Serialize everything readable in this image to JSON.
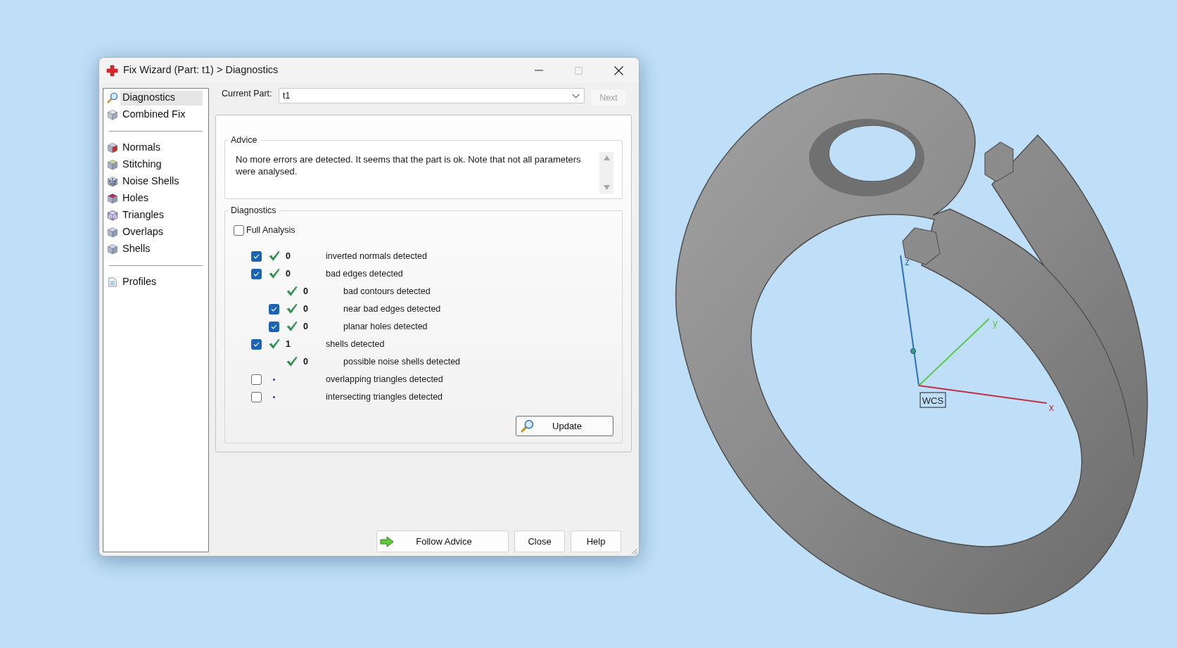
{
  "window": {
    "title": "Fix Wizard (Part: t1) > Diagnostics",
    "controls": [
      {
        "kind": "minimize",
        "disabled": false
      },
      {
        "kind": "maximize",
        "disabled": true
      },
      {
        "kind": "close",
        "disabled": false
      }
    ]
  },
  "sidebar": {
    "groups": [
      {
        "items": [
          {
            "label": "Diagnostics",
            "selected": true
          },
          {
            "label": "Combined Fix",
            "selected": false
          }
        ]
      },
      {
        "items": [
          {
            "label": "Normals",
            "selected": false
          },
          {
            "label": "Stitching",
            "selected": false
          },
          {
            "label": "Noise Shells",
            "selected": false
          },
          {
            "label": "Holes",
            "selected": false
          },
          {
            "label": "Triangles",
            "selected": false
          },
          {
            "label": "Overlaps",
            "selected": false
          },
          {
            "label": "Shells",
            "selected": false
          }
        ]
      },
      {
        "items": [
          {
            "label": "Profiles",
            "selected": false
          }
        ]
      }
    ]
  },
  "part_selector": {
    "label": "Current Part:",
    "value": "t1"
  },
  "next_button": {
    "label": "Next",
    "disabled": true
  },
  "advice": {
    "title": "Advice",
    "text": "No more errors are detected. It seems that the part is ok. Note that not all parameters were analysed."
  },
  "diagnostics": {
    "title": "Diagnostics",
    "full_analysis": {
      "label": "Full Analysis",
      "checked": false
    },
    "rows": [
      {
        "kind": "option",
        "checked": true,
        "passed": true,
        "count": "0",
        "label": "inverted normals detected"
      },
      {
        "kind": "option",
        "checked": true,
        "passed": true,
        "count": "0",
        "label": "bad edges detected",
        "children": [
          {
            "kind": "info",
            "passed": true,
            "count": "0",
            "label": "bad contours detected"
          },
          {
            "kind": "option",
            "checked": true,
            "passed": true,
            "count": "0",
            "label": "near bad edges detected"
          },
          {
            "kind": "option",
            "checked": true,
            "passed": true,
            "count": "0",
            "label": "planar holes detected"
          }
        ]
      },
      {
        "kind": "option",
        "checked": true,
        "passed": true,
        "count": "1",
        "label": "shells detected",
        "children": [
          {
            "kind": "info",
            "passed": true,
            "count": "0",
            "label": "possible noise shells detected"
          }
        ]
      },
      {
        "kind": "option",
        "checked": false,
        "passed": false,
        "label": "overlapping triangles detected"
      },
      {
        "kind": "option",
        "checked": false,
        "passed": false,
        "label": "intersecting triangles detected"
      }
    ],
    "update_button": "Update"
  },
  "buttons": [
    {
      "kind": "follow",
      "label": "Follow Advice"
    },
    {
      "kind": "plain",
      "label": "Close"
    },
    {
      "kind": "plain",
      "label": "Help"
    }
  ],
  "viewport": {
    "axes": [
      {
        "label": "z",
        "color": "#2f6fc0"
      },
      {
        "label": "y",
        "color": "#5cc94a"
      },
      {
        "label": "x",
        "color": "#c0304a"
      }
    ],
    "wcs_label": "WCS"
  }
}
